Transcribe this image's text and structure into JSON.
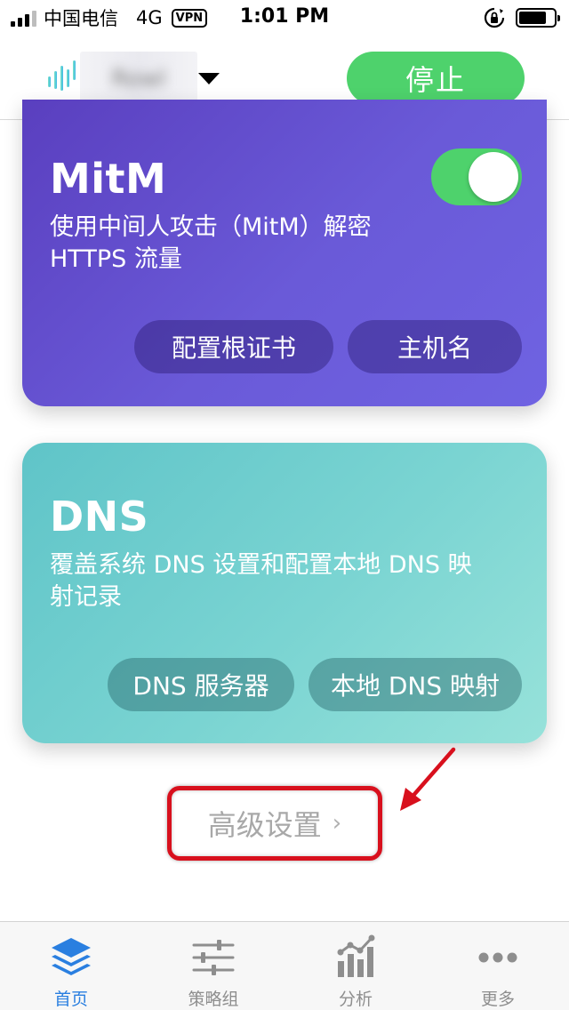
{
  "status_bar": {
    "carrier": "中国电信",
    "network": "4G",
    "vpn": "VPN",
    "time": "1:01 PM"
  },
  "header": {
    "profile_name": "Rowl",
    "stop_label": "停止"
  },
  "mitm_card": {
    "title": "MitM",
    "description_line1": "使用中间人攻击（MitM）解密",
    "description_line2": "HTTPS 流量",
    "toggle_on": true,
    "buttons": [
      "配置根证书",
      "主机名"
    ]
  },
  "dns_card": {
    "title": "DNS",
    "description_line1": "覆盖系统 DNS 设置和配置本地 DNS 映",
    "description_line2": "射记录",
    "buttons": [
      "DNS 服务器",
      "本地 DNS 映射"
    ]
  },
  "advanced": {
    "label": "高级设置",
    "chevron": "›"
  },
  "tab_bar": {
    "active_index": 0,
    "tabs": [
      {
        "label": "首页",
        "icon": "layers-icon"
      },
      {
        "label": "策略组",
        "icon": "sliders-icon"
      },
      {
        "label": "分析",
        "icon": "chart-icon"
      },
      {
        "label": "更多",
        "icon": "more-icon"
      }
    ]
  },
  "colors": {
    "accent_green": "#4ed26c",
    "mitm_card": "#6a5ad8",
    "dns_card": "#7ad4d2",
    "annotation_red": "#d8101d",
    "tab_active": "#2a7fe0"
  }
}
